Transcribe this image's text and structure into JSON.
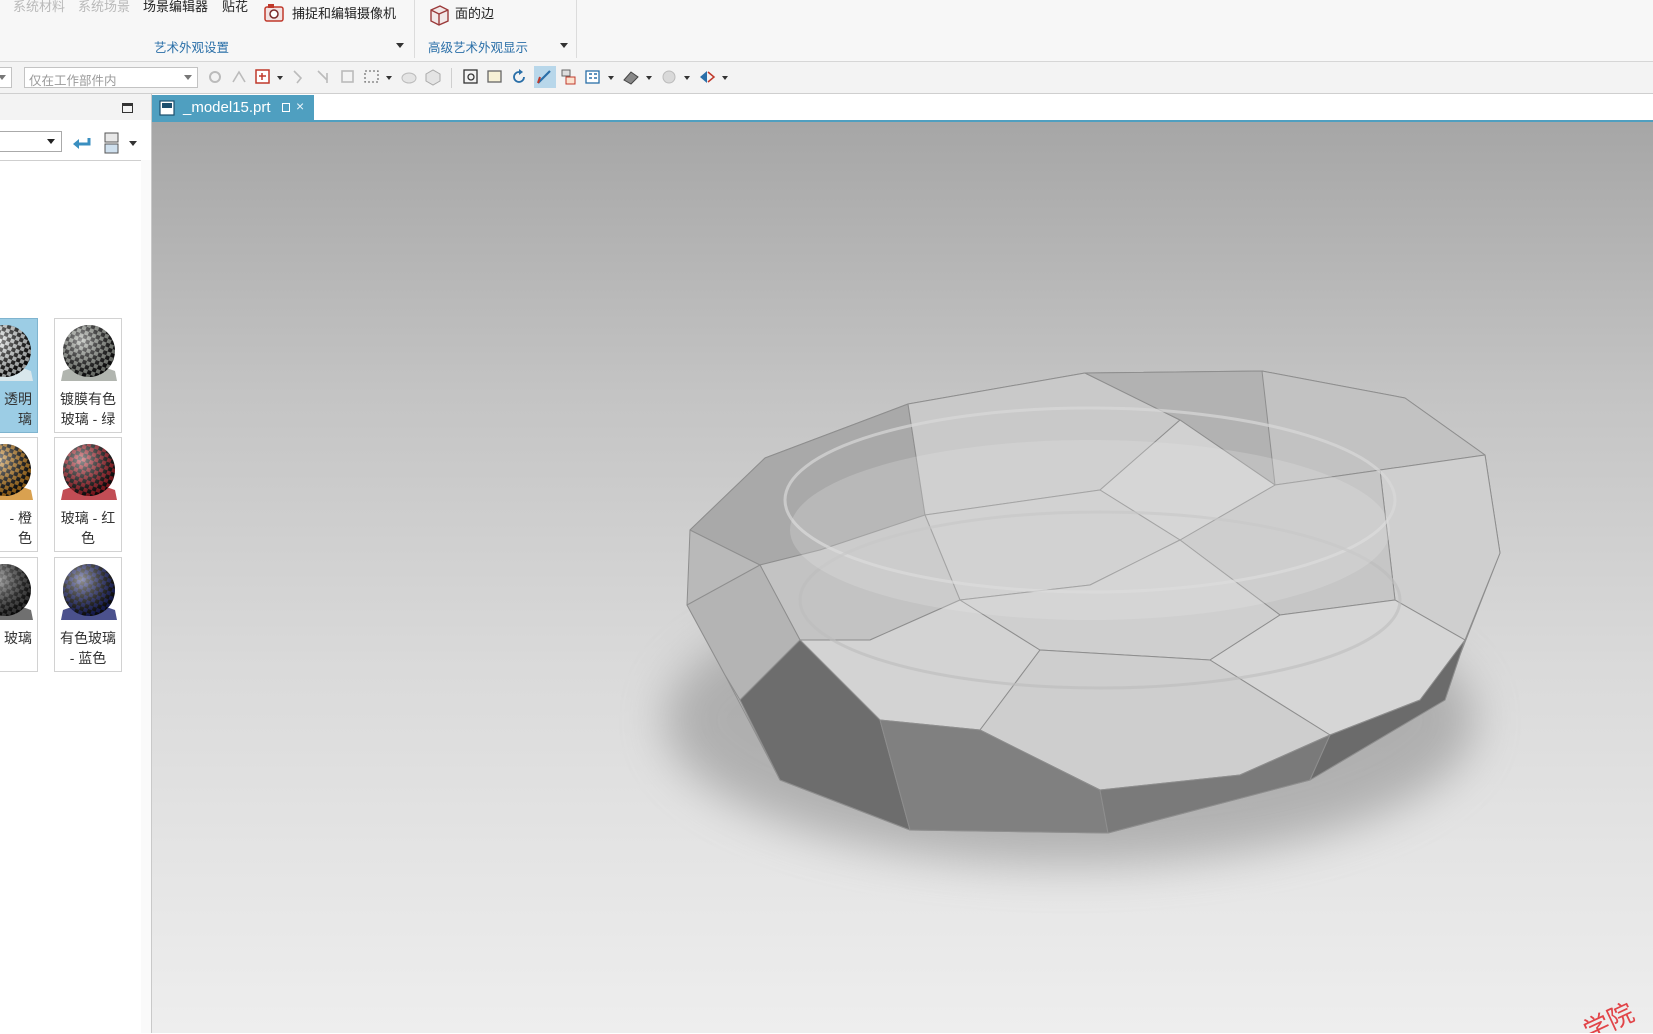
{
  "ribbon": {
    "items": {
      "system_materials": "系统材料",
      "system_scenes": "系统场景",
      "scene_editor": "场景编辑器",
      "decal": "贴花",
      "capture_camera": "捕捉和编辑摄像机",
      "face_edges": "面的边"
    },
    "groups": {
      "art_appearance": "艺术外观设置",
      "advanced_display": "高级艺术外观显示"
    }
  },
  "toolbar": {
    "scope_select": {
      "value": "仅在工作部件内"
    }
  },
  "material_panel": {
    "materials": [
      {
        "label": "透明\n璃",
        "selected": true,
        "ball_color": "#e9eeee"
      },
      {
        "label": "镀膜有色\n玻璃 - 绿",
        "selected": false,
        "ball_color": "#9ea39b"
      },
      {
        "label": "- 橙\n色",
        "selected": false,
        "ball_color": "#d08a24"
      },
      {
        "label": "玻璃 - 红\n色",
        "selected": false,
        "ball_color": "#b3202a"
      },
      {
        "label": "玻璃",
        "selected": false,
        "ball_color": "#4c4c4c"
      },
      {
        "label": "有色玻璃\n- 蓝色",
        "selected": false,
        "ball_color": "#1e2670"
      }
    ]
  },
  "viewport": {
    "tab_label": "_model15.prt",
    "tab_close": "×",
    "watermark": "学院"
  },
  "colors": {
    "accent": "#4f9fc0",
    "group_label": "#2a6fa8"
  }
}
